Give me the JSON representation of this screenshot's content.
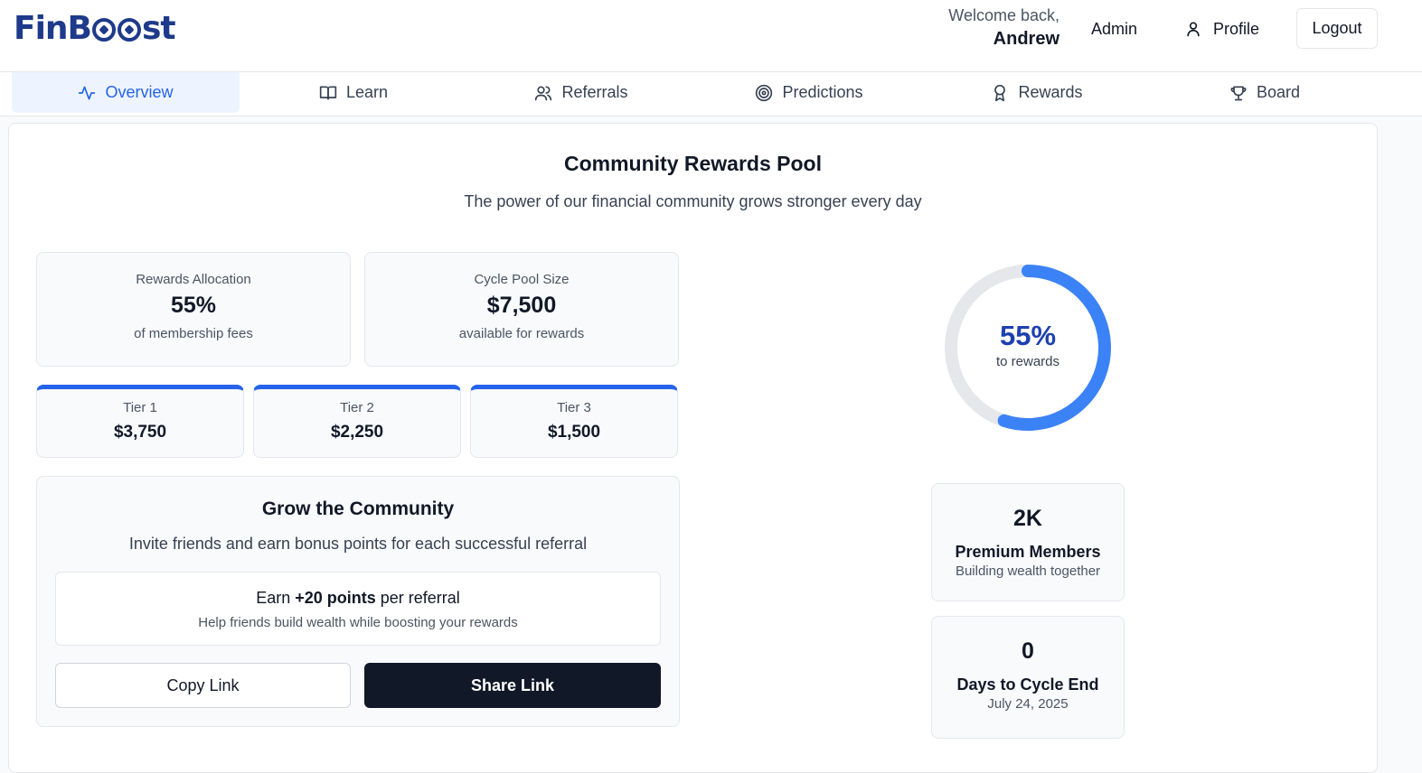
{
  "header": {
    "logo_prefix": "FinB",
    "logo_suffix": "st",
    "welcome_line": "Welcome back,",
    "user_name": "Andrew",
    "admin_label": "Admin",
    "profile_label": "Profile",
    "logout_label": "Logout"
  },
  "tabs": [
    {
      "label": "Overview",
      "icon": "activity-icon"
    },
    {
      "label": "Learn",
      "icon": "book-icon"
    },
    {
      "label": "Referrals",
      "icon": "users-icon"
    },
    {
      "label": "Predictions",
      "icon": "target-icon"
    },
    {
      "label": "Rewards",
      "icon": "award-icon"
    },
    {
      "label": "Board",
      "icon": "trophy-icon"
    }
  ],
  "pool": {
    "title": "Community Rewards Pool",
    "subtitle": "The power of our financial community grows stronger every day",
    "allocation": {
      "label": "Rewards Allocation",
      "value": "55%",
      "sub": "of membership fees"
    },
    "pool_size": {
      "label": "Cycle Pool Size",
      "value": "$7,500",
      "sub": "available for rewards"
    },
    "tiers": [
      {
        "label": "Tier 1",
        "value": "$3,750"
      },
      {
        "label": "Tier 2",
        "value": "$2,250"
      },
      {
        "label": "Tier 3",
        "value": "$1,500"
      }
    ],
    "ring": {
      "percent_text": "55%",
      "label": "to rewards",
      "fraction": 0.55,
      "color": "#3b82f6",
      "track_color": "#e5e7eb"
    }
  },
  "grow": {
    "title": "Grow the Community",
    "subtitle": "Invite friends and earn bonus points for each successful referral",
    "earn_prefix": "Earn ",
    "earn_bold": "+20 points",
    "earn_suffix": " per referral",
    "earn_sub": "Help friends build wealth while boosting your rewards",
    "copy_label": "Copy Link",
    "share_label": "Share Link"
  },
  "members": {
    "value": "2K",
    "title": "Premium Members",
    "sub": "Building wealth together"
  },
  "cycle": {
    "value": "0",
    "title": "Days to Cycle End",
    "sub": "July 24, 2025"
  }
}
